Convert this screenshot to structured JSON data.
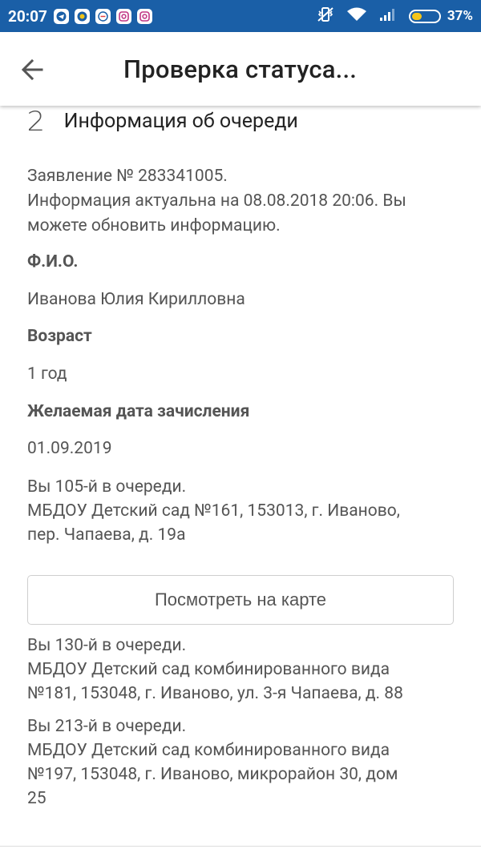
{
  "status_bar": {
    "time": "20:07",
    "battery": "37%",
    "battery_level": 0.37,
    "notification_icons": [
      "telegram-icon",
      "chat-icon",
      "messenger-icon",
      "instagram-icon",
      "instagram-icon"
    ]
  },
  "app_bar": {
    "title": "Проверка статуса..."
  },
  "section": {
    "step": "2",
    "title": "Информация об очереди"
  },
  "application": {
    "line1": "Заявление № 283341005.",
    "line2": "Информация актуальна на 08.08.2018 20:06. Вы",
    "line3": "можете обновить информацию."
  },
  "fields": [
    {
      "label": "Ф.И.О.",
      "value": "Иванова Юлия Кирилловна"
    },
    {
      "label": "Возраст",
      "value": "1 год"
    },
    {
      "label": "Желаемая дата зачисления",
      "value": "01.09.2019"
    }
  ],
  "queues": [
    {
      "lines": [
        "Вы 105-й в очереди.",
        "МБДОУ Детский сад №161, 153013, г. Иваново,",
        "пер. Чапаева, д. 19а"
      ]
    },
    {
      "lines": [
        "Вы 130-й в очереди.",
        "МБДОУ Детский сад комбинированного вида",
        "№181, 153048, г. Иваново, ул. 3-я Чапаева, д. 88"
      ]
    },
    {
      "lines": [
        "Вы 213-й в очереди.",
        "МБДОУ Детский сад комбинированного вида",
        "№197, 153048, г. Иваново, микрорайон 30, дом",
        "25"
      ]
    }
  ],
  "map_button": {
    "label": "Посмотреть на карте"
  }
}
